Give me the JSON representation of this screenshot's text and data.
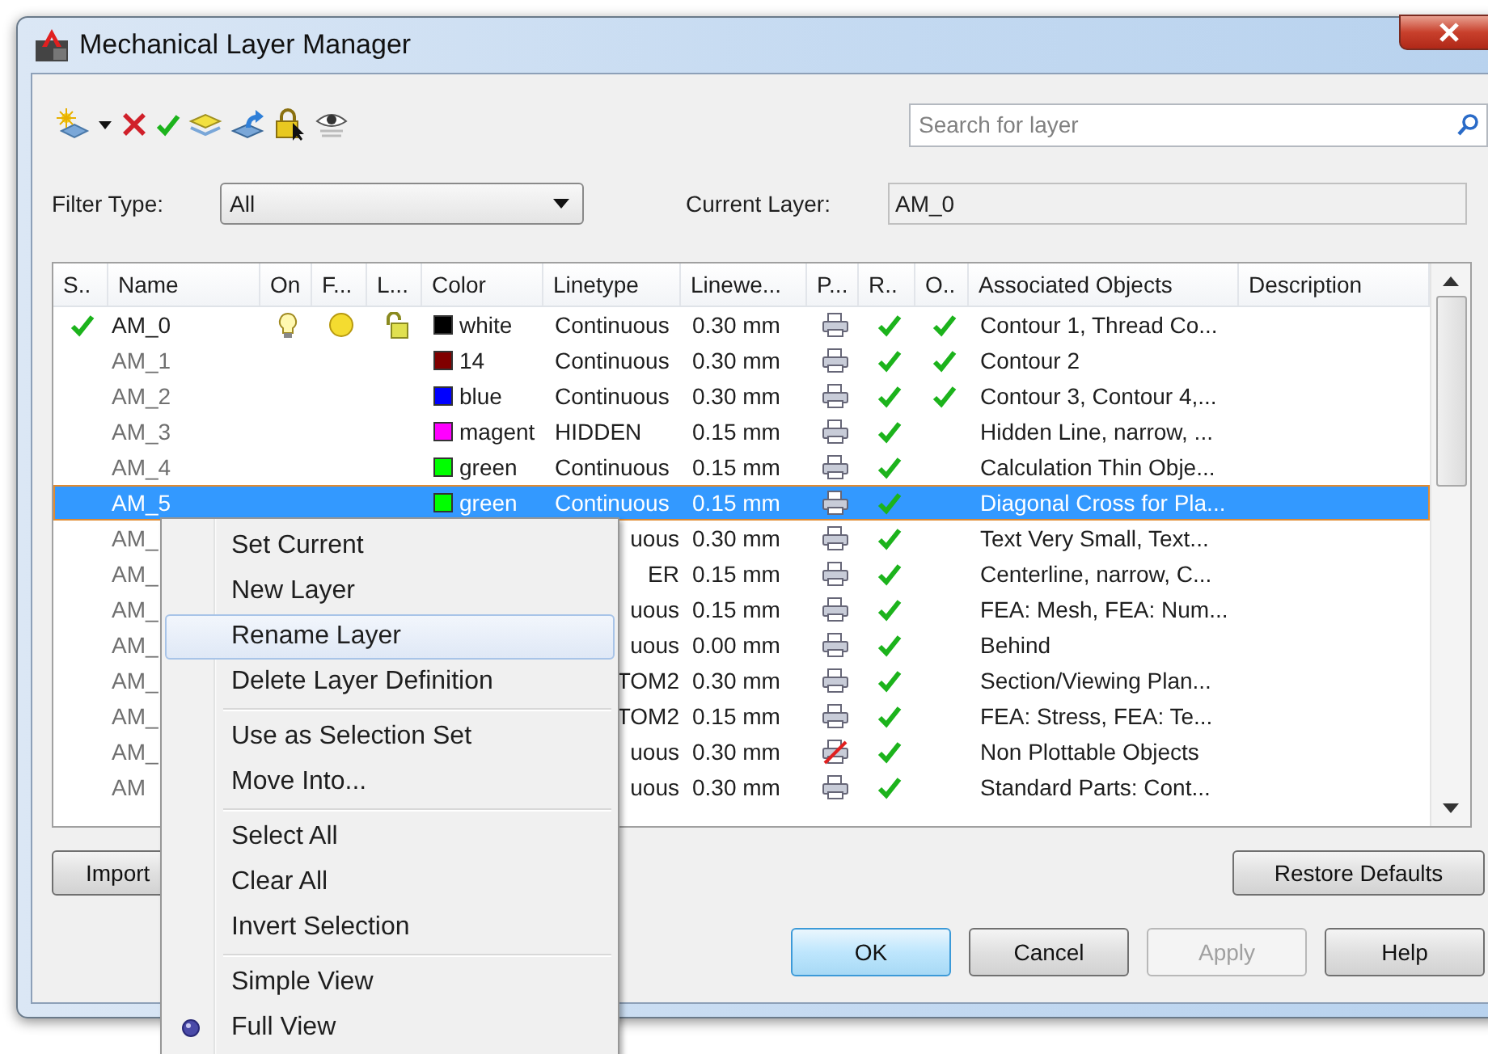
{
  "window": {
    "title": "Mechanical Layer Manager"
  },
  "search": {
    "placeholder": "Search for layer"
  },
  "filter": {
    "label": "Filter Type:",
    "value": "All"
  },
  "current_layer": {
    "label": "Current Layer:",
    "value": "AM_0"
  },
  "table": {
    "columns": [
      "S..",
      "Name",
      "On",
      "F...",
      "L...",
      "Color",
      "Linetype",
      "Linewe...",
      "P...",
      "R..",
      "O..",
      "Associated Objects",
      "Description"
    ],
    "rows": [
      {
        "current": true,
        "selected": false,
        "name": "AM_0",
        "state_icons": true,
        "color_name": "white",
        "color": "#000000",
        "linetype": "Continuous",
        "linetype_partial": false,
        "lineweight": "0.30 mm",
        "plottable": true,
        "r": true,
        "o": true,
        "associated": "Contour 1, Thread Co..."
      },
      {
        "current": false,
        "selected": false,
        "name": "AM_1",
        "state_icons": false,
        "color_name": "14",
        "color": "#800000",
        "linetype": "Continuous",
        "linetype_partial": false,
        "lineweight": "0.30 mm",
        "plottable": true,
        "r": true,
        "o": true,
        "associated": "Contour 2"
      },
      {
        "current": false,
        "selected": false,
        "name": "AM_2",
        "state_icons": false,
        "color_name": "blue",
        "color": "#0000ff",
        "linetype": "Continuous",
        "linetype_partial": false,
        "lineweight": "0.30 mm",
        "plottable": true,
        "r": true,
        "o": true,
        "associated": "Contour 3, Contour 4,..."
      },
      {
        "current": false,
        "selected": false,
        "name": "AM_3",
        "state_icons": false,
        "color_name": "magent",
        "color": "#ff00ff",
        "linetype": "HIDDEN",
        "linetype_partial": false,
        "lineweight": "0.15 mm",
        "plottable": true,
        "r": true,
        "o": false,
        "associated": "Hidden Line, narrow, ..."
      },
      {
        "current": false,
        "selected": false,
        "name": "AM_4",
        "state_icons": false,
        "color_name": "green",
        "color": "#00ff00",
        "linetype": "Continuous",
        "linetype_partial": false,
        "lineweight": "0.15 mm",
        "plottable": true,
        "r": true,
        "o": false,
        "associated": "Calculation Thin Obje..."
      },
      {
        "current": false,
        "selected": true,
        "name": "AM_5",
        "state_icons": false,
        "color_name": "green",
        "color": "#00ff00",
        "linetype": "Continuous",
        "linetype_partial": false,
        "lineweight": "0.15 mm",
        "plottable": true,
        "r": true,
        "o": false,
        "associated": "Diagonal Cross for Pla..."
      },
      {
        "current": false,
        "selected": false,
        "name": "AM_",
        "state_icons": false,
        "linetype": "uous",
        "linetype_partial": true,
        "lineweight": "0.30 mm",
        "plottable": true,
        "r": true,
        "o": false,
        "associated": "Text Very Small, Text..."
      },
      {
        "current": false,
        "selected": false,
        "name": "AM_",
        "state_icons": false,
        "linetype": "ER",
        "linetype_partial": true,
        "lineweight": "0.15 mm",
        "plottable": true,
        "r": true,
        "o": false,
        "associated": "Centerline, narrow, C..."
      },
      {
        "current": false,
        "selected": false,
        "name": "AM_",
        "state_icons": false,
        "linetype": "uous",
        "linetype_partial": true,
        "lineweight": "0.15 mm",
        "plottable": true,
        "r": true,
        "o": false,
        "associated": "FEA: Mesh, FEA: Num..."
      },
      {
        "current": false,
        "selected": false,
        "name": "AM_",
        "state_icons": false,
        "linetype": "uous",
        "linetype_partial": true,
        "lineweight": "0.00 mm",
        "plottable": true,
        "r": true,
        "o": false,
        "associated": "Behind"
      },
      {
        "current": false,
        "selected": false,
        "name": "AM_",
        "state_icons": false,
        "linetype": "TOM2",
        "linetype_partial": true,
        "lineweight": "0.30 mm",
        "plottable": true,
        "r": true,
        "o": false,
        "associated": "Section/Viewing Plan..."
      },
      {
        "current": false,
        "selected": false,
        "name": "AM_",
        "state_icons": false,
        "linetype": "TOM2",
        "linetype_partial": true,
        "lineweight": "0.15 mm",
        "plottable": true,
        "r": true,
        "o": false,
        "associated": "FEA: Stress, FEA: Te..."
      },
      {
        "current": false,
        "selected": false,
        "name": "AM_",
        "state_icons": false,
        "linetype": "uous",
        "linetype_partial": true,
        "lineweight": "0.30 mm",
        "plottable": false,
        "r": true,
        "o": false,
        "associated": "Non Plottable Objects"
      },
      {
        "current": false,
        "selected": false,
        "name": "AM",
        "state_icons": false,
        "linetype": "uous",
        "linetype_partial": true,
        "lineweight": "0.30 mm",
        "plottable": true,
        "r": true,
        "o": false,
        "associated": "Standard Parts: Cont..."
      }
    ]
  },
  "import_button": {
    "label": "Import"
  },
  "restore_button": {
    "label": "Restore Defaults"
  },
  "buttons": [
    {
      "label": "OK",
      "default": true,
      "disabled": false
    },
    {
      "label": "Cancel",
      "default": false,
      "disabled": false
    },
    {
      "label": "Apply",
      "default": false,
      "disabled": true
    },
    {
      "label": "Help",
      "default": false,
      "disabled": false
    }
  ],
  "context_menu": {
    "items": [
      {
        "kind": "item",
        "label": "Set Current",
        "highlighted": false,
        "checked": false
      },
      {
        "kind": "item",
        "label": "New Layer",
        "highlighted": false,
        "checked": false
      },
      {
        "kind": "item",
        "label": "Rename Layer",
        "highlighted": true,
        "checked": false
      },
      {
        "kind": "item",
        "label": "Delete Layer Definition",
        "highlighted": false,
        "checked": false
      },
      {
        "kind": "separator"
      },
      {
        "kind": "item",
        "label": "Use as Selection Set",
        "highlighted": false,
        "checked": false
      },
      {
        "kind": "item",
        "label": "Move Into...",
        "highlighted": false,
        "checked": false
      },
      {
        "kind": "separator"
      },
      {
        "kind": "item",
        "label": "Select All",
        "highlighted": false,
        "checked": false
      },
      {
        "kind": "item",
        "label": "Clear All",
        "highlighted": false,
        "checked": false
      },
      {
        "kind": "item",
        "label": "Invert Selection",
        "highlighted": false,
        "checked": false
      },
      {
        "kind": "separator"
      },
      {
        "kind": "item",
        "label": "Simple View",
        "highlighted": false,
        "checked": false
      },
      {
        "kind": "item",
        "label": "Full View",
        "highlighted": false,
        "checked": true
      }
    ]
  }
}
